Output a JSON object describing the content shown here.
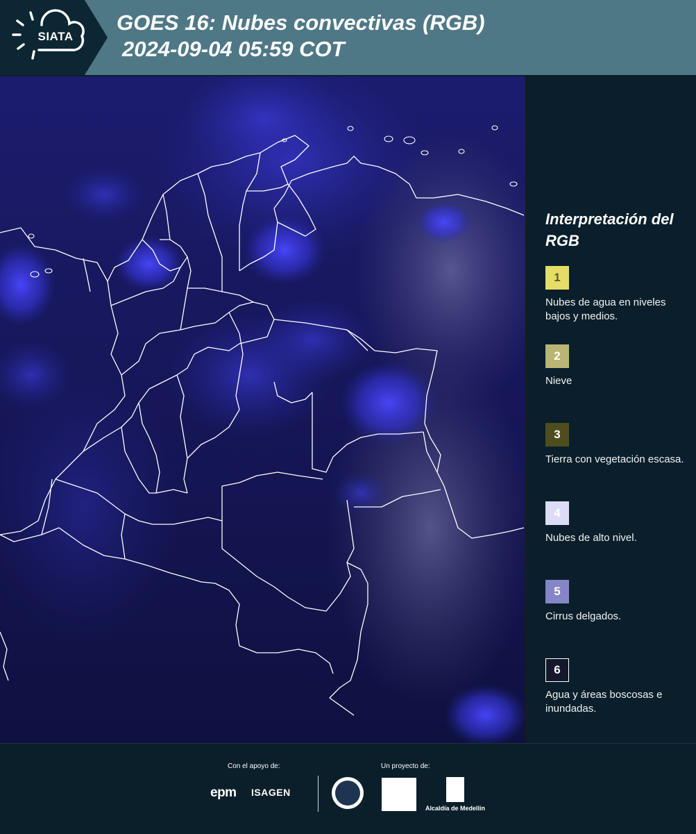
{
  "header": {
    "logo_text": "SIATA",
    "title_line1": "GOES 16: Nubes convectivas (RGB)",
    "title_line2": "2024-09-04 05:59 COT"
  },
  "legend": {
    "title": "Interpretación del RGB",
    "items": [
      {
        "number": "1",
        "label": "Nubes de agua en niveles bajos y medios.",
        "color": "#e4dd66",
        "text_color": "#5c5a2a"
      },
      {
        "number": "2",
        "label": "Nieve",
        "color": "#b9b574",
        "text_color": "#ffffff"
      },
      {
        "number": "3",
        "label": "Tierra con vegetación escasa.",
        "color": "#4e4d1e",
        "text_color": "#ffffff"
      },
      {
        "number": "4",
        "label": "Nubes de alto nivel.",
        "color": "#dcdcf6",
        "text_color": "#ffffff"
      },
      {
        "number": "5",
        "label": "Cirrus delgados.",
        "color": "#8585c8",
        "text_color": "#ffffff"
      },
      {
        "number": "6",
        "label": "Agua y áreas boscosas e inundadas.",
        "color": "#15172e",
        "text_color": "#ffffff"
      }
    ]
  },
  "footer": {
    "support_label": "Con el apoyo de:",
    "project_label": "Un proyecto de:",
    "sponsor1": "epm",
    "sponsor2": "ISAGEN",
    "partner_alcaldia": "Alcaldía de Medellín"
  },
  "colors": {
    "header_bg": "#4f7886",
    "page_bg": "#0a1f2b",
    "map_bg": "#15154f"
  }
}
